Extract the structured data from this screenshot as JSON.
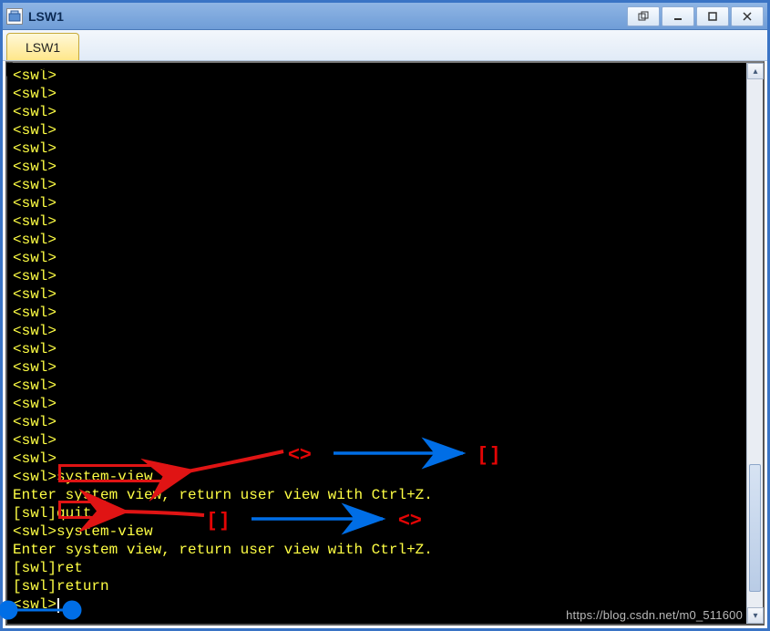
{
  "window": {
    "title": "LSW1"
  },
  "tabs": [
    {
      "label": "LSW1"
    }
  ],
  "terminal": {
    "lines": [
      "<swl>",
      "<swl>",
      "<swl>",
      "<swl>",
      "<swl>",
      "<swl>",
      "<swl>",
      "<swl>",
      "<swl>",
      "<swl>",
      "<swl>",
      "<swl>",
      "<swl>",
      "<swl>",
      "<swl>",
      "<swl>",
      "<swl>",
      "<swl>",
      "<swl>",
      "<swl>",
      "<swl>",
      "<swl>",
      "<swl>system-view",
      "Enter system view, return user view with Ctrl+Z.",
      "[swl]quit",
      "<swl>system-view",
      "Enter system view, return user view with Ctrl+Z.",
      "[swl]ret",
      "[swl]return",
      "<swl>"
    ]
  },
  "annotations": {
    "row1_left": "<>",
    "row1_right": "[ ]",
    "row2_left": "[ ]",
    "row2_right": "<>"
  },
  "watermark": "https://blog.csdn.net/m0_511600"
}
